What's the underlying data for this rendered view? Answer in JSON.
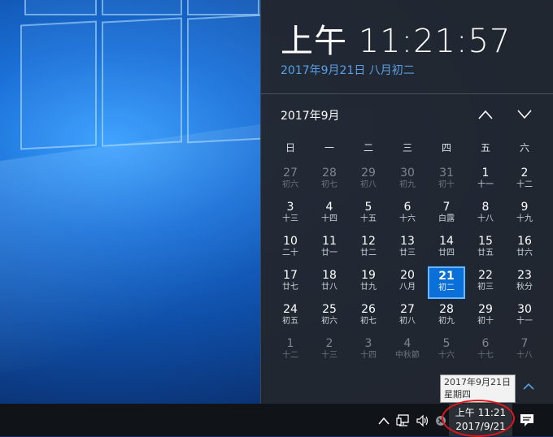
{
  "flyout": {
    "time": "上午 11:21:57",
    "date_link": "2017年9月21日 八月初二",
    "month_label": "2017年9月"
  },
  "weekdays": [
    "日",
    "一",
    "二",
    "三",
    "四",
    "五",
    "六"
  ],
  "weeks": [
    [
      {
        "n": "27",
        "l": "初六",
        "out": true
      },
      {
        "n": "28",
        "l": "初七",
        "out": true
      },
      {
        "n": "29",
        "l": "初八",
        "out": true
      },
      {
        "n": "30",
        "l": "初九",
        "out": true
      },
      {
        "n": "31",
        "l": "初十",
        "out": true
      },
      {
        "n": "1",
        "l": "十一"
      },
      {
        "n": "2",
        "l": "十二"
      }
    ],
    [
      {
        "n": "3",
        "l": "十三"
      },
      {
        "n": "4",
        "l": "十四"
      },
      {
        "n": "5",
        "l": "十五"
      },
      {
        "n": "6",
        "l": "十六"
      },
      {
        "n": "7",
        "l": "白露"
      },
      {
        "n": "8",
        "l": "十八"
      },
      {
        "n": "9",
        "l": "十九"
      }
    ],
    [
      {
        "n": "10",
        "l": "二十"
      },
      {
        "n": "11",
        "l": "廿一"
      },
      {
        "n": "12",
        "l": "廿二"
      },
      {
        "n": "13",
        "l": "廿三"
      },
      {
        "n": "14",
        "l": "廿四"
      },
      {
        "n": "15",
        "l": "廿五"
      },
      {
        "n": "16",
        "l": "廿六"
      }
    ],
    [
      {
        "n": "17",
        "l": "廿七"
      },
      {
        "n": "18",
        "l": "廿八"
      },
      {
        "n": "19",
        "l": "廿九"
      },
      {
        "n": "20",
        "l": "八月"
      },
      {
        "n": "21",
        "l": "初二",
        "today": true
      },
      {
        "n": "22",
        "l": "初三"
      },
      {
        "n": "23",
        "l": "秋分"
      }
    ],
    [
      {
        "n": "24",
        "l": "初五"
      },
      {
        "n": "25",
        "l": "初六"
      },
      {
        "n": "26",
        "l": "初七"
      },
      {
        "n": "27",
        "l": "初八"
      },
      {
        "n": "28",
        "l": "初九"
      },
      {
        "n": "29",
        "l": "初十"
      },
      {
        "n": "30",
        "l": "十一"
      }
    ],
    [
      {
        "n": "1",
        "l": "十二",
        "out": true
      },
      {
        "n": "2",
        "l": "十三",
        "out": true
      },
      {
        "n": "3",
        "l": "十四",
        "out": true
      },
      {
        "n": "4",
        "l": "中秋節",
        "out": true
      },
      {
        "n": "5",
        "l": "十六",
        "out": true
      },
      {
        "n": "6",
        "l": "十七",
        "out": true
      },
      {
        "n": "7",
        "l": "十八",
        "out": true
      }
    ]
  ],
  "tooltip": {
    "line1": "2017年9月21日",
    "line2": "星期四"
  },
  "taskbar": {
    "clock_time": "上午 11:21",
    "clock_date": "2017/9/21"
  },
  "icons": {
    "prev_month": "chevron-up-icon",
    "next_month": "chevron-down-icon",
    "expand": "chevron-up-icon",
    "tray_overflow": "chevron-up-icon",
    "network": "network-icon",
    "volume": "speaker-icon",
    "notifications": "action-center-icon"
  },
  "colors": {
    "accent": "#0a6fd6",
    "link": "#5aa0e6",
    "flyout_bg": "#22272e",
    "highlight": "#e0161b"
  }
}
